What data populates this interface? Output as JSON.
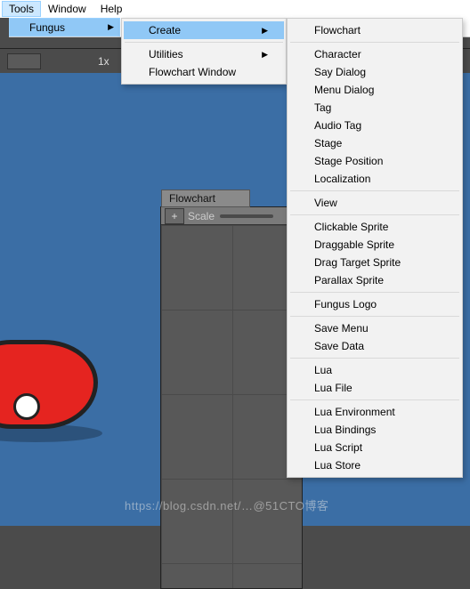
{
  "menubar": {
    "tools": "Tools",
    "window": "Window",
    "help": "Help"
  },
  "fungus_row": {
    "label": "Fungus"
  },
  "toolbar": {
    "zoom": "1x"
  },
  "flowchart_panel": {
    "tab": "Flowchart",
    "plus": "+",
    "scale": "Scale"
  },
  "menu1": {
    "create": "Create",
    "utilities": "Utilities",
    "flowchart_window": "Flowchart Window"
  },
  "menu2": {
    "g1": [
      "Flowchart"
    ],
    "g2": [
      "Character",
      "Say Dialog",
      "Menu Dialog",
      "Tag",
      "Audio Tag",
      "Stage",
      "Stage Position",
      "Localization"
    ],
    "g3": [
      "View"
    ],
    "g4": [
      "Clickable Sprite",
      "Draggable Sprite",
      "Drag Target Sprite",
      "Parallax Sprite"
    ],
    "g5": [
      "Fungus Logo"
    ],
    "g6": [
      "Save Menu",
      "Save Data"
    ],
    "g7": [
      "Lua",
      "Lua File"
    ],
    "g8": [
      "Lua Environment",
      "Lua Bindings",
      "Lua Script",
      "Lua Store"
    ]
  },
  "watermark": "https://blog.csdn.net/…@51CTO博客"
}
